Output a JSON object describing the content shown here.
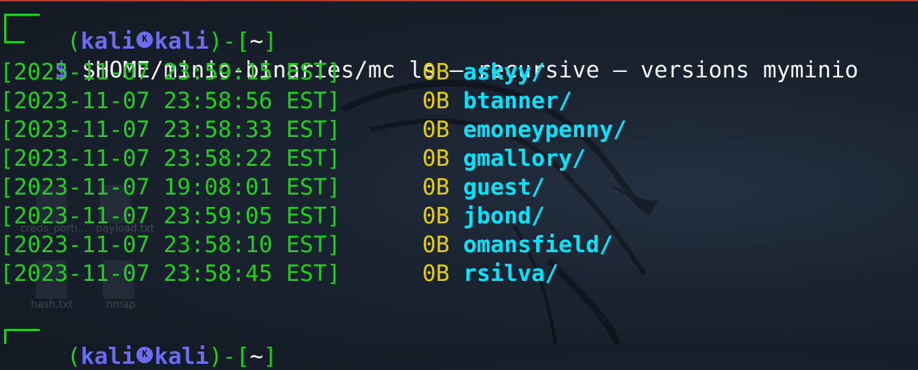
{
  "terminal": {
    "prompt": {
      "user": "kali",
      "host": "kali",
      "dir": "~",
      "symbol": "$",
      "skull_glyph": "K"
    },
    "command": "$HOME/minio-binaries/mc ls — recursive — versions myminio",
    "entries": [
      {
        "timestamp": "[2023-11-07 23:59:15 EST]",
        "size": "0B",
        "name": "askyy/"
      },
      {
        "timestamp": "[2023-11-07 23:58:56 EST]",
        "size": "0B",
        "name": "btanner/"
      },
      {
        "timestamp": "[2023-11-07 23:58:33 EST]",
        "size": "0B",
        "name": "emoneypenny/"
      },
      {
        "timestamp": "[2023-11-07 23:58:22 EST]",
        "size": "0B",
        "name": "gmallory/"
      },
      {
        "timestamp": "[2023-11-07 19:08:01 EST]",
        "size": "0B",
        "name": "guest/"
      },
      {
        "timestamp": "[2023-11-07 23:59:05 EST]",
        "size": "0B",
        "name": "jbond/"
      },
      {
        "timestamp": "[2023-11-07 23:58:10 EST]",
        "size": "0B",
        "name": "omansfield/"
      },
      {
        "timestamp": "[2023-11-07 23:58:45 EST]",
        "size": "0B",
        "name": "rsilva/"
      }
    ]
  },
  "desktop": {
    "labels": [
      "creds_porti...",
      "payload.txt",
      "hash.txt",
      "nmap"
    ]
  },
  "colors": {
    "green": "#1fd01f",
    "blue": "#6b6cf0",
    "yellow": "#e6cf00",
    "cyan": "#00e5ff"
  }
}
